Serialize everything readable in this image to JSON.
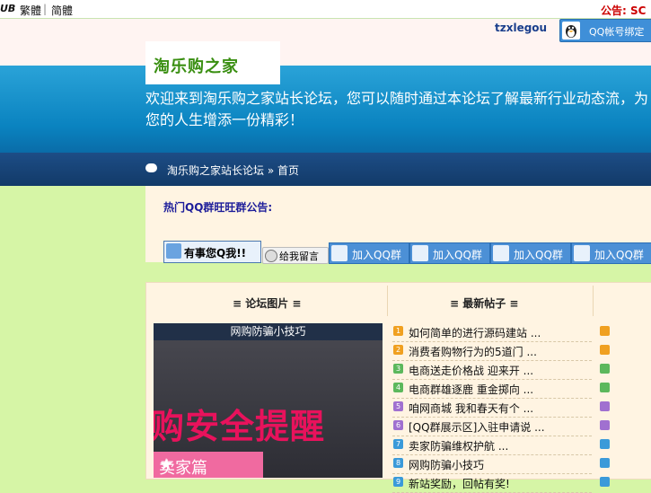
{
  "topbar": {
    "logo_text": "UB",
    "traditional": "繁體",
    "simplified": "简體",
    "notice": "公告: SC"
  },
  "user": {
    "name": "tzxlegou",
    "qq_bind_label": "QQ帐号绑定"
  },
  "banner": {
    "site_name": "淘乐购之家",
    "welcome": "欢迎来到淘乐购之家站长论坛，您可以随时通过本论坛了解最新行业动态流，为您的人生增添一份精彩！"
  },
  "breadcrumb": {
    "forum": "淘乐购之家站长论坛",
    "separator": "»",
    "current": "首页"
  },
  "announcement": {
    "title": "热门QQ群旺旺群公告:",
    "talk_button": "有事您Q我!!",
    "message_button": "给我留言",
    "join_buttons": [
      "加入QQ群",
      "加入QQ群",
      "加入QQ群",
      "加入QQ群"
    ]
  },
  "sections": {
    "pics_header": "≡ 论坛图片 ≡",
    "posts_header": "≡ 最新帖子 ≡"
  },
  "picture": {
    "caption": "网购防骗小技巧",
    "headline": "购安全提醒",
    "tag": "卖家篇"
  },
  "posts": [
    {
      "num": "1",
      "color": "#f0a020",
      "title": "如何简单的进行源码建站 ..."
    },
    {
      "num": "2",
      "color": "#f0a020",
      "title": "消费者购物行为的5道门 ..."
    },
    {
      "num": "3",
      "color": "#5cb85c",
      "title": "电商送走价格战 迎来开 ..."
    },
    {
      "num": "4",
      "color": "#5cb85c",
      "title": "电商群雄逐鹿 重金掷向 ..."
    },
    {
      "num": "5",
      "color": "#a070d0",
      "title": "咱网商城 我和春天有个 ..."
    },
    {
      "num": "6",
      "color": "#a070d0",
      "title": "[QQ群展示区]入驻申请说 ..."
    },
    {
      "num": "7",
      "color": "#3a9ad9",
      "title": "卖家防骗维权护航 ..."
    },
    {
      "num": "8",
      "color": "#3a9ad9",
      "title": "网购防骗小技巧"
    },
    {
      "num": "9",
      "color": "#3a9ad9",
      "title": "新站奖励，回帖有奖!"
    }
  ],
  "right_markers": [
    "#f0a020",
    "#f0a020",
    "#5cb85c",
    "#5cb85c",
    "#a070d0",
    "#a070d0",
    "#3a9ad9",
    "#3a9ad9",
    "#3a9ad9"
  ]
}
